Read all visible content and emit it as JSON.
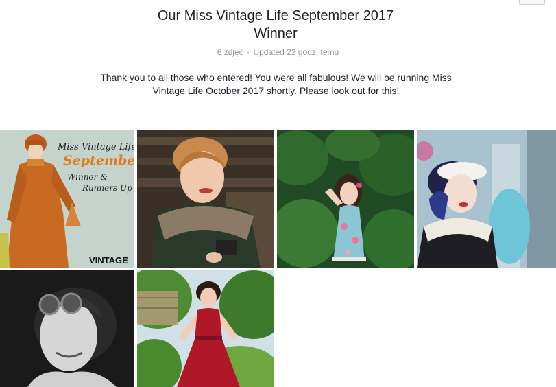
{
  "album": {
    "title": "Our Miss Vintage Life September 2017 Winner",
    "photo_count": "6 zdjęć",
    "separator": "·",
    "updated": "Updated 22 godz. temu",
    "description": "Thank you to all those who entered! You were all fabulous! We will be running Miss Vintage Life October 2017 shortly. Please look out for this!"
  },
  "photos": [
    {
      "id": "poster",
      "poster_line1": "Miss Vintage Life",
      "poster_line2": "September",
      "poster_line3": "Winner &",
      "poster_line4": "Runners Up",
      "brand": "VINTAGE"
    },
    {
      "id": "woman-fur-collar-camera"
    },
    {
      "id": "woman-floral-dress-forest"
    },
    {
      "id": "woman-white-beret-shopwindow"
    },
    {
      "id": "woman-goggles-bw"
    },
    {
      "id": "woman-red-dress-garden"
    }
  ],
  "colors": {
    "accent_orange": "#e07a1d",
    "text_dark": "#1d2129",
    "text_muted": "#90949c"
  }
}
